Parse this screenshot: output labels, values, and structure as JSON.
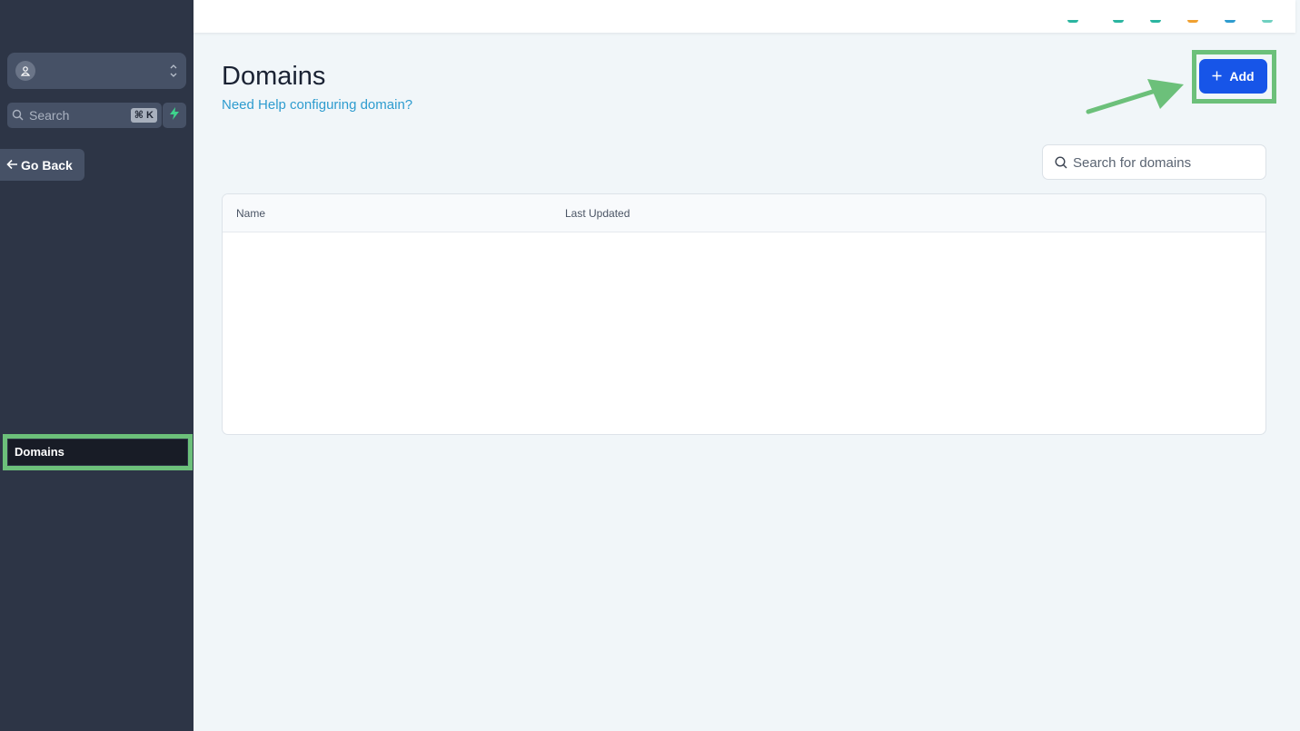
{
  "sidebar": {
    "search": {
      "placeholder": "Search",
      "shortcut": "⌘ K"
    },
    "go_back_label": "Go Back",
    "nav_items": [
      {
        "label": "Domains"
      }
    ]
  },
  "topbar": {
    "status_dot_colors": [
      "#2bb5a0",
      "#2bb5a0",
      "#2bb5a0",
      "#f0a030",
      "#2e9ccf",
      "#6fd0c0"
    ]
  },
  "main": {
    "title": "Domains",
    "help_link": "Need Help configuring domain?",
    "add_button": "Add",
    "search_placeholder": "Search for domains",
    "table": {
      "columns": [
        "Name",
        "Last Updated"
      ],
      "rows": []
    }
  },
  "colors": {
    "sidebar_bg": "#2d3546",
    "accent_blue": "#1755e8",
    "link_blue": "#2e9ccf",
    "highlight_green": "#6cc07a"
  }
}
